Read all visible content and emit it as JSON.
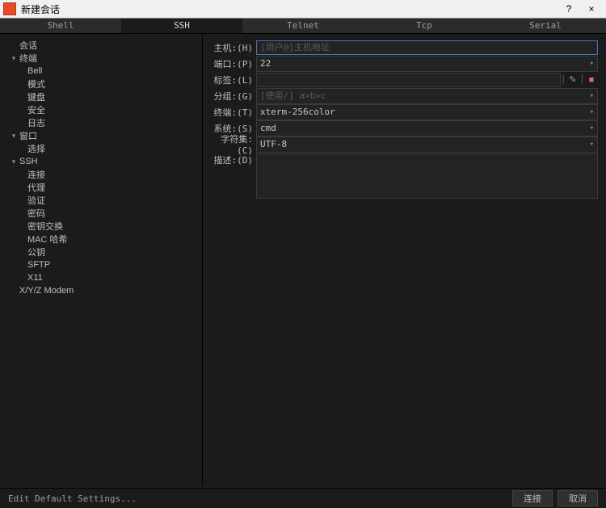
{
  "window": {
    "title": "新建会话"
  },
  "tabs": [
    {
      "label": "Shell",
      "active": false,
      "key": "shell"
    },
    {
      "label": "SSH",
      "active": true,
      "key": "ssh",
      "underline": "S"
    },
    {
      "label": "Telnet",
      "active": false,
      "key": "telnet",
      "underline": "T"
    },
    {
      "label": "Tcp",
      "active": false,
      "key": "tcp"
    },
    {
      "label": "Serial",
      "active": false,
      "key": "serial",
      "underline": "S"
    }
  ],
  "sidebar": [
    {
      "label": "会话",
      "depth": 0,
      "expandable": false
    },
    {
      "label": "终端",
      "depth": 1,
      "expandable": true,
      "expanded": true
    },
    {
      "label": "Bell",
      "depth": 2
    },
    {
      "label": "模式",
      "depth": 2
    },
    {
      "label": "键盘",
      "depth": 2
    },
    {
      "label": "安全",
      "depth": 2
    },
    {
      "label": "日志",
      "depth": 2
    },
    {
      "label": "窗口",
      "depth": 1,
      "expandable": true,
      "expanded": true
    },
    {
      "label": "选择",
      "depth": 2
    },
    {
      "label": "SSH",
      "depth": 1,
      "expandable": true,
      "expanded": true
    },
    {
      "label": "连接",
      "depth": 2
    },
    {
      "label": "代理",
      "depth": 2
    },
    {
      "label": "验证",
      "depth": 2
    },
    {
      "label": "密码",
      "depth": 2
    },
    {
      "label": "密钥交换",
      "depth": 2
    },
    {
      "label": "MAC 哈希",
      "depth": 2
    },
    {
      "label": "公钥",
      "depth": 2
    },
    {
      "label": "SFTP",
      "depth": 2
    },
    {
      "label": "X11",
      "depth": 2
    },
    {
      "label": "X/Y/Z Modem",
      "depth": 1,
      "expandable": false
    }
  ],
  "form": {
    "host": {
      "label": "主机:(H)",
      "value": "",
      "placeholder": "[用户@]主机地址"
    },
    "port": {
      "label": "端口:(P)",
      "value": "22"
    },
    "tag": {
      "label": "标签:(L)",
      "value": ""
    },
    "group": {
      "label": "分组:(G)",
      "value": "",
      "placeholder": "[使用/] a>b>c"
    },
    "terminal": {
      "label": "终端:(T)",
      "value": "xterm-256color"
    },
    "system": {
      "label": "系统:(S)",
      "value": "cmd"
    },
    "charset": {
      "label": "字符集:(C)",
      "value": "UTF-8"
    },
    "desc": {
      "label": "描述:(D)",
      "value": ""
    }
  },
  "footer": {
    "edit_defaults": "Edit Default Settings...",
    "connect": "连接",
    "cancel": "取消"
  }
}
